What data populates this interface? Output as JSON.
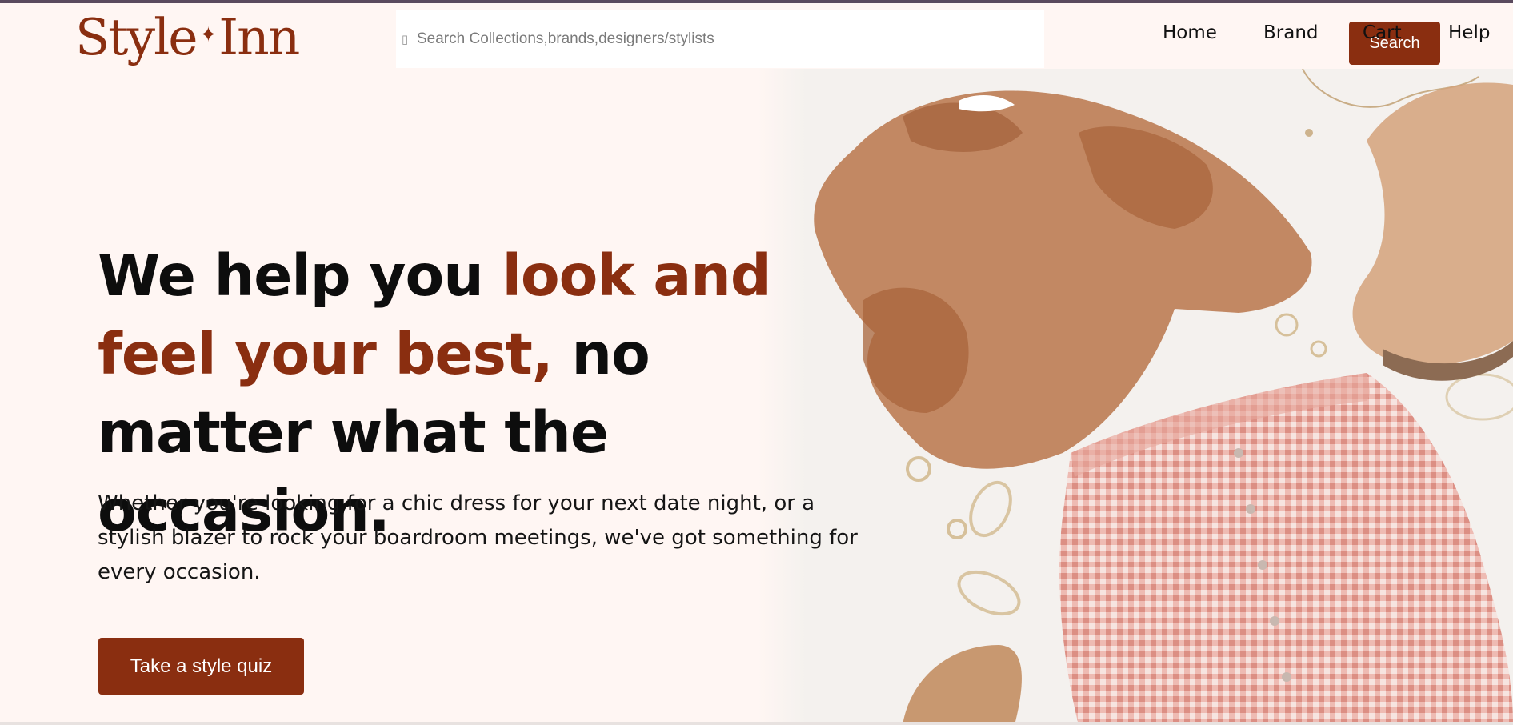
{
  "brand": {
    "name_part1": "Style",
    "name_part2": "Inn",
    "spark": "✦"
  },
  "search": {
    "placeholder": "Search Collections,brands,designers/stylists",
    "icon": "search-icon",
    "button_label": "Search"
  },
  "nav": {
    "items": [
      {
        "label": "Home"
      },
      {
        "label": "Brand"
      },
      {
        "label": "Cart"
      },
      {
        "label": "Help"
      }
    ]
  },
  "hero": {
    "headline_part1": "We help you ",
    "headline_accent": "look and feel your best,",
    "headline_part2": " no matter what the occasion.",
    "subtext": "Whether you're looking for a chic dress for your next date night, or a stylish blazer to rock your boardroom meetings, we've got something for every occasion.",
    "cta_label": "Take a style quiz",
    "image_alt": "Flat lay: rust knit sweater, tan lace-up boots, red gingham skirt and gold jewelry"
  },
  "colors": {
    "accent": "#8a2e10",
    "background": "#fff6f3",
    "text": "#0d0d0d"
  }
}
